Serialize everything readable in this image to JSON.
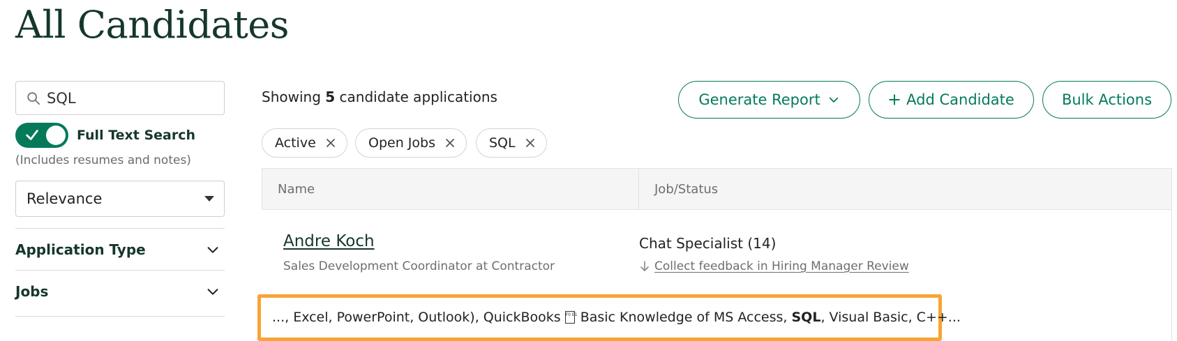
{
  "page": {
    "title": "All Candidates"
  },
  "sidebar": {
    "search": {
      "value": "SQL",
      "placeholder": ""
    },
    "full_text_search": {
      "label": "Full Text Search",
      "hint": "(Includes resumes and notes)",
      "enabled": true
    },
    "sort": {
      "selected": "Relevance"
    },
    "filters": [
      {
        "label": "Application Type"
      },
      {
        "label": "Jobs"
      }
    ]
  },
  "main": {
    "showing": {
      "prefix": "Showing",
      "count": "5",
      "suffix": "candidate applications"
    },
    "buttons": {
      "generate_report": "Generate Report",
      "add_candidate": "Add Candidate",
      "bulk_actions": "Bulk Actions"
    },
    "chips": [
      "Active",
      "Open Jobs",
      "SQL"
    ],
    "table": {
      "headers": [
        "Name",
        "Job/Status"
      ],
      "rows": [
        {
          "name": "Andre Koch",
          "subtitle": "Sales Development Coordinator at Contractor",
          "job": "Chat Specialist (14)",
          "status": "Collect feedback in Hiring Manager Review",
          "snippet_before": "..., Excel, PowerPoint, Outlook), QuickBooks",
          "snippet_glyph": "F0 E1",
          "snippet_mid": "Basic Knowledge of MS Access,",
          "snippet_match": "SQL",
          "snippet_after": ", Visual Basic, C++..."
        }
      ]
    }
  },
  "colors": {
    "brand_green": "#047a5b",
    "title_dark": "#15372c",
    "highlight_orange": "#f6a536"
  }
}
